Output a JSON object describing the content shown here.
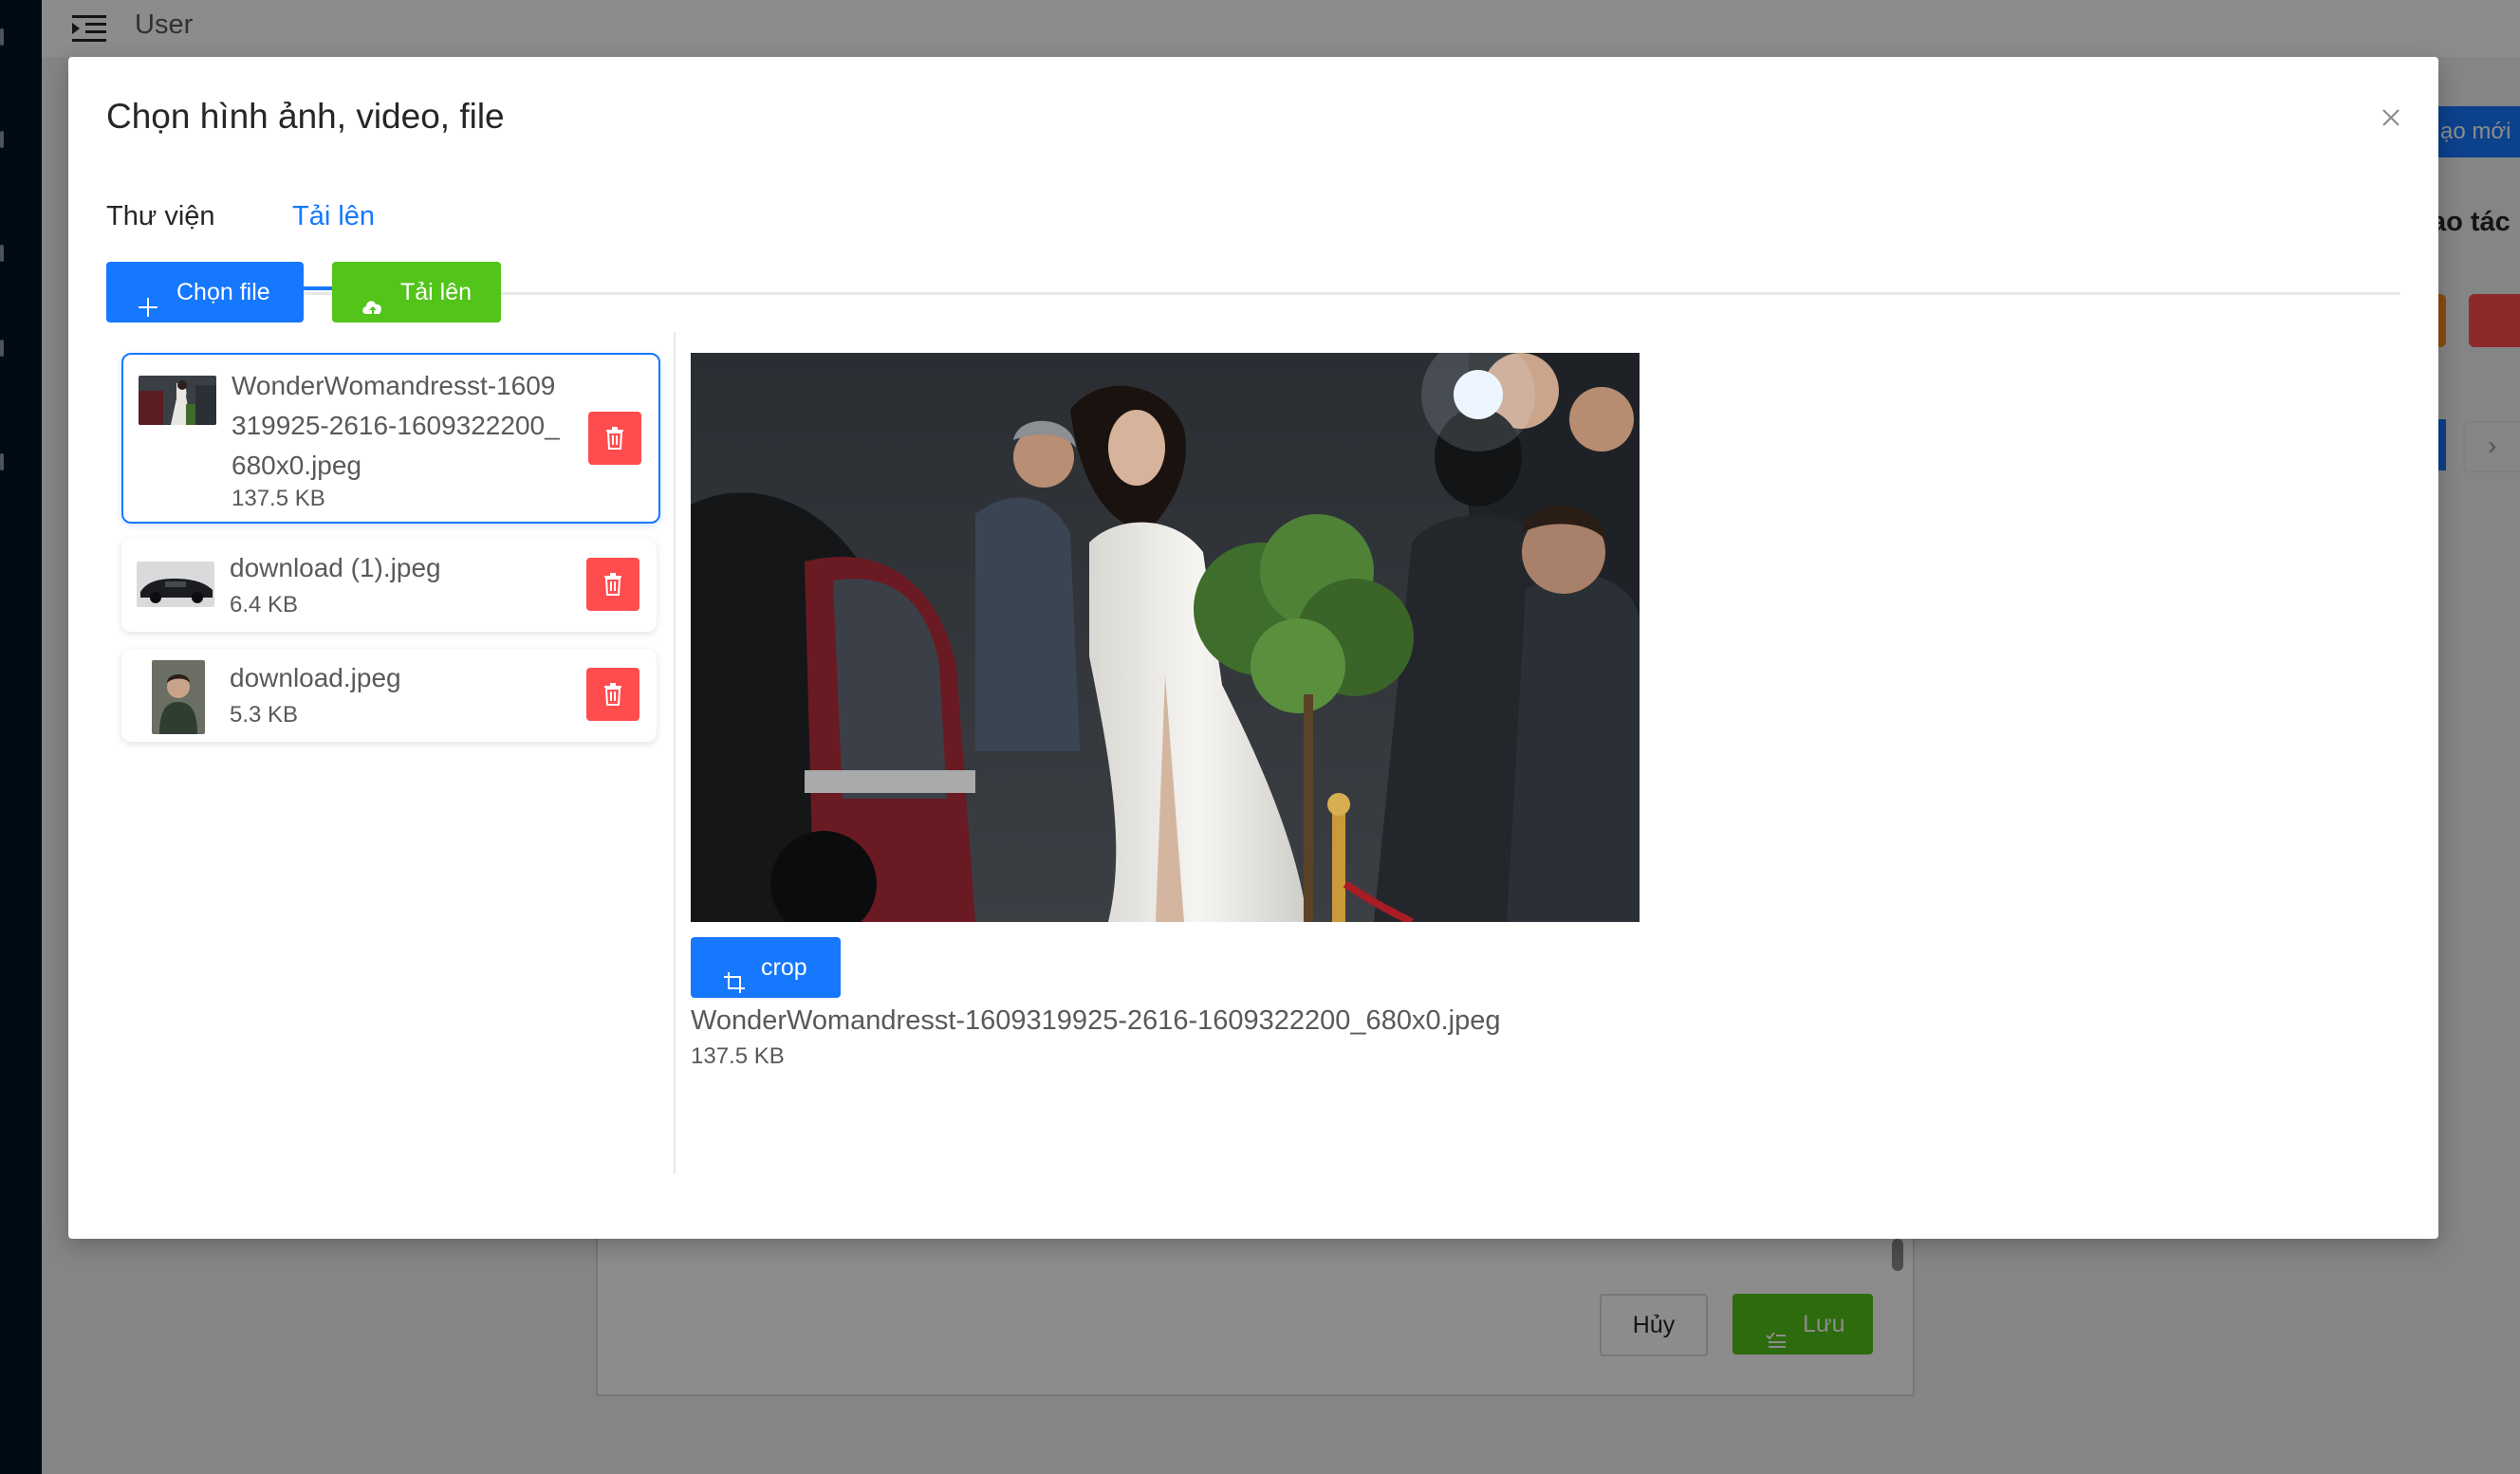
{
  "app": {
    "header_title": "User",
    "create_button_label": "ạo mới",
    "actions_header": "ao tác",
    "form_cancel_label": "Hủy",
    "form_save_label": "Lưu"
  },
  "modal": {
    "title": "Chọn hình ảnh, video, file",
    "tabs": [
      {
        "label": "Thư viện",
        "active": false
      },
      {
        "label": "Tải lên",
        "active": true
      }
    ],
    "toolbar": {
      "choose_file_label": "Chọn file",
      "upload_label": "Tải lên"
    },
    "files": [
      {
        "name": "WonderWomandresst-1609319925-2616-1609322200_680x0.jpeg",
        "size": "137.5 KB",
        "selected": true
      },
      {
        "name": "download (1).jpeg",
        "size": "6.4 KB",
        "selected": false
      },
      {
        "name": "download.jpeg",
        "size": "5.3 KB",
        "selected": false
      }
    ],
    "preview": {
      "crop_label": "crop",
      "file_name": "WonderWomandresst-1609319925-2616-1609322200_680x0.jpeg",
      "file_size": "137.5 KB"
    }
  },
  "colors": {
    "primary": "#1677ff",
    "success": "#52c41a",
    "danger": "#ff4d4f",
    "sidebar": "#001529"
  },
  "icons": {
    "menu": "menu-fold-icon",
    "close": "close-icon",
    "plus": "plus-icon",
    "upload": "cloud-upload-icon",
    "delete": "trash-icon",
    "crop": "crop-icon",
    "save": "check-list-icon"
  }
}
